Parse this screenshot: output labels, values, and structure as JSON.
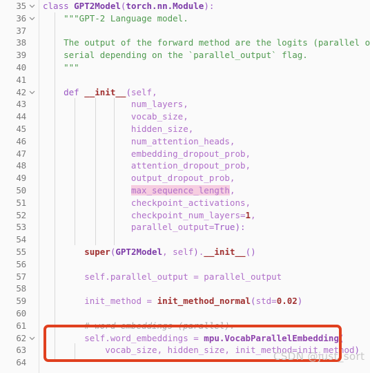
{
  "editor": {
    "language": "Python",
    "first_line": 35,
    "colors": {
      "background": "#fafafa",
      "gutter_text": "#7a7a7a",
      "keyword": "#9b59c4",
      "class_name": "#7d3ca8",
      "function": "#a03030",
      "string": "#4f9a4f",
      "comment": "#a6a6a6",
      "identifier": "#b06fc9",
      "highlight": "#f6cde0",
      "annotation_red": "#e0401f",
      "indent_guide": "#d8d8d8"
    }
  },
  "lines": [
    {
      "n": "35",
      "fold": "down",
      "text": "class GPT2Model(torch.nn.Module):"
    },
    {
      "n": "36",
      "fold": "down",
      "text": "    \"\"\"GPT-2 Language model."
    },
    {
      "n": "37",
      "fold": "none",
      "text": ""
    },
    {
      "n": "38",
      "fold": "none",
      "text": "    The output of the forward method are the logits (parallel or"
    },
    {
      "n": "39",
      "fold": "none",
      "text": "    serial depending on the `parallel_output` flag."
    },
    {
      "n": "40",
      "fold": "none",
      "text": "    \"\"\""
    },
    {
      "n": "41",
      "fold": "none",
      "text": ""
    },
    {
      "n": "42",
      "fold": "down",
      "text": "    def __init__(self,"
    },
    {
      "n": "43",
      "fold": "none",
      "text": "                 num_layers,"
    },
    {
      "n": "44",
      "fold": "none",
      "text": "                 vocab_size,"
    },
    {
      "n": "45",
      "fold": "none",
      "text": "                 hidden_size,"
    },
    {
      "n": "46",
      "fold": "none",
      "text": "                 num_attention_heads,"
    },
    {
      "n": "47",
      "fold": "none",
      "text": "                 embedding_dropout_prob,"
    },
    {
      "n": "48",
      "fold": "none",
      "text": "                 attention_dropout_prob,"
    },
    {
      "n": "49",
      "fold": "none",
      "text": "                 output_dropout_prob,"
    },
    {
      "n": "50",
      "fold": "none",
      "text": "                 max_sequence_length,"
    },
    {
      "n": "51",
      "fold": "none",
      "text": "                 checkpoint_activations,"
    },
    {
      "n": "52",
      "fold": "none",
      "text": "                 checkpoint_num_layers=1,"
    },
    {
      "n": "53",
      "fold": "none",
      "text": "                 parallel_output=True):"
    },
    {
      "n": "54",
      "fold": "none",
      "text": ""
    },
    {
      "n": "55",
      "fold": "none",
      "text": "        super(GPT2Model, self).__init__()"
    },
    {
      "n": "56",
      "fold": "none",
      "text": ""
    },
    {
      "n": "57",
      "fold": "none",
      "text": "        self.parallel_output = parallel_output"
    },
    {
      "n": "58",
      "fold": "none",
      "text": ""
    },
    {
      "n": "59",
      "fold": "none",
      "text": "        init_method = init_method_normal(std=0.02)"
    },
    {
      "n": "60",
      "fold": "none",
      "text": ""
    },
    {
      "n": "61",
      "fold": "none",
      "text": "        # word embeddings (parallel)."
    },
    {
      "n": "62",
      "fold": "down",
      "text": "        self.word_embeddings = mpu.VocabParallelEmbedding("
    },
    {
      "n": "63",
      "fold": "none",
      "text": "            vocab_size, hidden_size, init_method=init_method)"
    },
    {
      "n": "64",
      "fold": "none",
      "text": ""
    }
  ],
  "highlight": {
    "token": "max_sequence_length",
    "on_line": "50"
  },
  "annotation": {
    "kind": "red-rectangle",
    "covers_lines": [
      "61",
      "62",
      "63"
    ],
    "color": "#e0401f"
  },
  "watermark": {
    "text": "CSDN @just_sort"
  }
}
